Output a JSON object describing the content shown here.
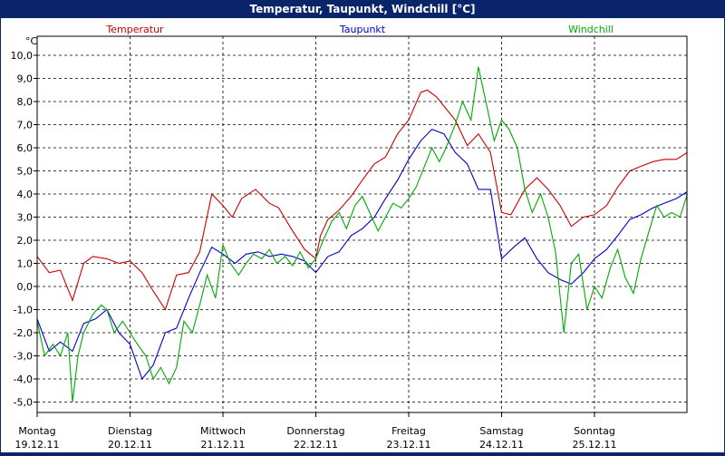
{
  "window": {
    "title": "Temperatur, Taupunkt, Windchill [°C]"
  },
  "chart_data": {
    "type": "line",
    "title": "Temperatur, Taupunkt, Windchill [°C]",
    "ylabel": "°C",
    "ylim": [
      -6,
      12
    ],
    "ytick_labels": [
      "10,0",
      "9,0",
      "8,0",
      "7,0",
      "6,0",
      "5,0",
      "4,0",
      "3,0",
      "2,0",
      "1,0",
      "0,0",
      "-1,0",
      "-2,0",
      "-3,0",
      "-4,0",
      "-5,0"
    ],
    "ytick_values": [
      10,
      9,
      8,
      7,
      6,
      5,
      4,
      3,
      2,
      1,
      0,
      -1,
      -2,
      -3,
      -4,
      -5
    ],
    "xlim": [
      0,
      7
    ],
    "x_ticks": [
      {
        "day": "Montag",
        "date": "19.12.11"
      },
      {
        "day": "Dienstag",
        "date": "20.12.11"
      },
      {
        "day": "Mittwoch",
        "date": "21.12.11"
      },
      {
        "day": "Donnerstag",
        "date": "22.12.11"
      },
      {
        "day": "Freitag",
        "date": "23.12.11"
      },
      {
        "day": "Samstag",
        "date": "24.12.11"
      },
      {
        "day": "Sonntag",
        "date": "25.12.11"
      }
    ],
    "grid": true,
    "legend_position": "top",
    "series": [
      {
        "name": "Temperatur",
        "color": "#cc0000",
        "x": [
          0,
          0.13,
          0.25,
          0.38,
          0.5,
          0.6,
          0.75,
          0.88,
          1,
          1.13,
          1.25,
          1.38,
          1.5,
          1.63,
          1.75,
          1.88,
          2,
          2.1,
          2.2,
          2.35,
          2.5,
          2.6,
          2.75,
          2.88,
          3,
          3.05,
          3.13,
          3.25,
          3.38,
          3.5,
          3.63,
          3.75,
          3.88,
          4,
          4.13,
          4.2,
          4.3,
          4.38,
          4.5,
          4.63,
          4.75,
          4.88,
          5,
          5.1,
          5.25,
          5.38,
          5.5,
          5.63,
          5.75,
          5.88,
          6,
          6.13,
          6.25,
          6.38,
          6.5,
          6.63,
          6.75,
          6.88,
          7
        ],
        "values": [
          1.3,
          0.6,
          0.7,
          -0.6,
          1.0,
          1.3,
          1.2,
          1.0,
          1.1,
          0.6,
          -0.2,
          -1.0,
          0.5,
          0.6,
          1.5,
          4.0,
          3.5,
          3.0,
          3.8,
          4.2,
          3.6,
          3.4,
          2.4,
          1.6,
          1.2,
          2.2,
          2.9,
          3.3,
          3.9,
          4.6,
          5.3,
          5.6,
          6.6,
          7.2,
          8.4,
          8.5,
          8.2,
          7.8,
          7.2,
          6.1,
          6.6,
          5.8,
          3.2,
          3.1,
          4.2,
          4.7,
          4.2,
          3.5,
          2.6,
          3.0,
          3.1,
          3.5,
          4.3,
          5.0,
          5.2,
          5.4,
          5.5,
          5.5,
          5.8
        ]
      },
      {
        "name": "Taupunkt",
        "color": "#0000cc",
        "x": [
          0,
          0.13,
          0.25,
          0.38,
          0.5,
          0.63,
          0.75,
          0.88,
          1,
          1.13,
          1.25,
          1.38,
          1.5,
          1.63,
          1.75,
          1.88,
          2,
          2.13,
          2.25,
          2.38,
          2.5,
          2.63,
          2.75,
          2.88,
          3,
          3.13,
          3.25,
          3.38,
          3.5,
          3.63,
          3.75,
          3.88,
          4,
          4.13,
          4.25,
          4.38,
          4.5,
          4.63,
          4.75,
          4.88,
          5,
          5.13,
          5.25,
          5.38,
          5.5,
          5.63,
          5.75,
          5.88,
          6,
          6.13,
          6.25,
          6.38,
          6.5,
          6.63,
          6.75,
          6.88,
          7
        ],
        "values": [
          -1.4,
          -2.8,
          -2.4,
          -2.8,
          -1.6,
          -1.4,
          -1.0,
          -2.0,
          -2.5,
          -4.0,
          -3.4,
          -2.0,
          -1.8,
          -0.5,
          0.6,
          1.7,
          1.4,
          1.0,
          1.4,
          1.5,
          1.3,
          1.4,
          1.3,
          1.1,
          0.6,
          1.3,
          1.5,
          2.2,
          2.5,
          3.0,
          3.8,
          4.6,
          5.5,
          6.3,
          6.8,
          6.6,
          5.8,
          5.3,
          4.2,
          4.2,
          1.2,
          1.7,
          2.1,
          1.2,
          0.6,
          0.3,
          0.1,
          0.6,
          1.2,
          1.6,
          2.2,
          2.9,
          3.1,
          3.4,
          3.6,
          3.8,
          4.1
        ]
      },
      {
        "name": "Windchill",
        "color": "#00aa00",
        "x": [
          0,
          0.08,
          0.17,
          0.25,
          0.33,
          0.38,
          0.44,
          0.5,
          0.6,
          0.69,
          0.75,
          0.83,
          0.92,
          1,
          1.08,
          1.17,
          1.25,
          1.33,
          1.42,
          1.5,
          1.58,
          1.67,
          1.75,
          1.83,
          1.92,
          2,
          2.08,
          2.17,
          2.25,
          2.33,
          2.42,
          2.5,
          2.58,
          2.67,
          2.75,
          2.83,
          2.92,
          3,
          3.08,
          3.17,
          3.25,
          3.33,
          3.42,
          3.5,
          3.58,
          3.67,
          3.75,
          3.83,
          3.92,
          4,
          4.08,
          4.17,
          4.25,
          4.33,
          4.38,
          4.42,
          4.5,
          4.58,
          4.67,
          4.75,
          4.83,
          4.92,
          5,
          5.08,
          5.17,
          5.25,
          5.33,
          5.42,
          5.5,
          5.58,
          5.67,
          5.75,
          5.83,
          5.92,
          6,
          6.08,
          6.17,
          6.25,
          6.33,
          6.42,
          6.5,
          6.58,
          6.67,
          6.75,
          6.83,
          6.92,
          7
        ],
        "values": [
          -1.5,
          -3.0,
          -2.5,
          -3.0,
          -2.0,
          -5.0,
          -3.0,
          -2.0,
          -1.2,
          -0.8,
          -1.0,
          -2.0,
          -1.5,
          -2.0,
          -2.5,
          -3.0,
          -4.0,
          -3.5,
          -4.2,
          -3.5,
          -1.5,
          -2.0,
          -0.8,
          0.5,
          -0.5,
          1.8,
          1.0,
          0.5,
          1.0,
          1.4,
          1.2,
          1.6,
          1.0,
          1.3,
          0.9,
          1.5,
          0.8,
          1.2,
          2.0,
          2.8,
          3.2,
          2.5,
          3.5,
          3.9,
          3.2,
          2.4,
          3.0,
          3.6,
          3.4,
          3.8,
          4.3,
          5.2,
          6.0,
          5.4,
          5.8,
          6.2,
          7.0,
          8.0,
          7.2,
          9.5,
          8.0,
          6.3,
          7.2,
          6.8,
          6.0,
          4.2,
          3.2,
          4.0,
          3.0,
          1.5,
          -2.0,
          1.0,
          1.4,
          -1.0,
          0.0,
          -0.5,
          0.8,
          1.6,
          0.4,
          -0.3,
          1.2,
          2.3,
          3.5,
          3.0,
          3.2,
          3.0,
          4.0
        ]
      }
    ]
  }
}
